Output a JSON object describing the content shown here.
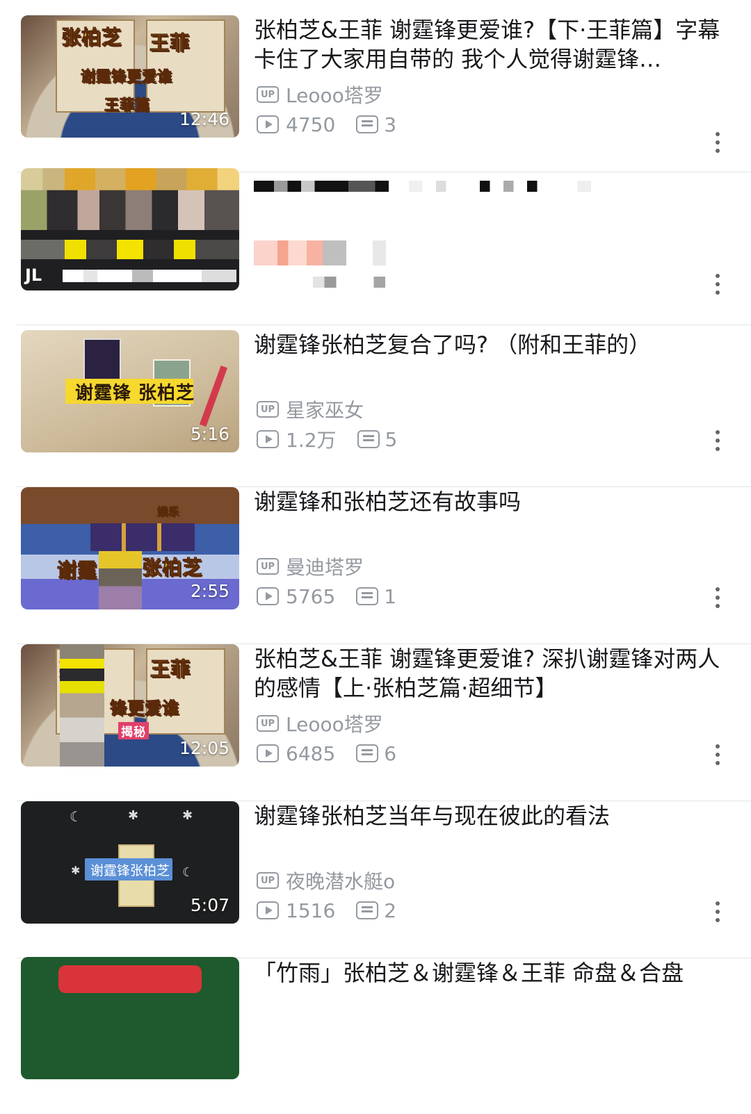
{
  "videos": [
    {
      "title": "张柏芝&王菲 谢霆锋更爱谁?【下·王菲篇】字幕卡住了大家用自带的 我个人觉得谢霆锋…",
      "uploader": "Leooo塔罗",
      "views": "4750",
      "comments": "3",
      "duration": "12:46",
      "thumb_text": [
        "张柏芝",
        "王菲",
        "谢霆锋更爱谁",
        "王菲篇"
      ]
    },
    {
      "title": "",
      "uploader": "",
      "views": "",
      "comments": "",
      "duration": "",
      "thumb_text": [
        "JL"
      ]
    },
    {
      "title": "谢霆锋张柏芝复合了吗? （附和王菲的）",
      "uploader": "星家巫女",
      "views": "1.2万",
      "comments": "5",
      "duration": "5:16",
      "thumb_text": [
        "谢霆锋 张柏芝"
      ]
    },
    {
      "title": "谢霆锋和张柏芝还有故事吗",
      "uploader": "曼迪塔罗",
      "views": "5765",
      "comments": "1",
      "duration": "2:55",
      "thumb_text": [
        "谢霆",
        "张柏芝",
        "娱乐"
      ]
    },
    {
      "title": "张柏芝&王菲 谢霆锋更爱谁? 深扒谢霆锋对两人的感情【上·张柏芝篇·超细节】",
      "uploader": "Leooo塔罗",
      "views": "6485",
      "comments": "6",
      "duration": "12:05",
      "thumb_text": [
        "张",
        "王菲",
        "锋更爱谁",
        "揭秘"
      ]
    },
    {
      "title": "谢霆锋张柏芝当年与现在彼此的看法",
      "uploader": "夜晚潜水艇o",
      "views": "1516",
      "comments": "2",
      "duration": "5:07",
      "thumb_text": [
        "谢霆锋张柏芝"
      ]
    },
    {
      "title": "「竹雨」张柏芝＆谢霆锋＆王菲 命盘＆合盘",
      "uploader": "",
      "views": "",
      "comments": "",
      "duration": "",
      "thumb_text": []
    }
  ],
  "labels": {
    "up_badge": "UP"
  },
  "icons": {
    "play": "play-icon",
    "comment": "comment-icon",
    "more": "more-vertical-icon",
    "up": "up-badge-icon"
  },
  "colors": {
    "meta": "#9499a0",
    "title": "#18191c",
    "divider": "#e3e5e7"
  }
}
